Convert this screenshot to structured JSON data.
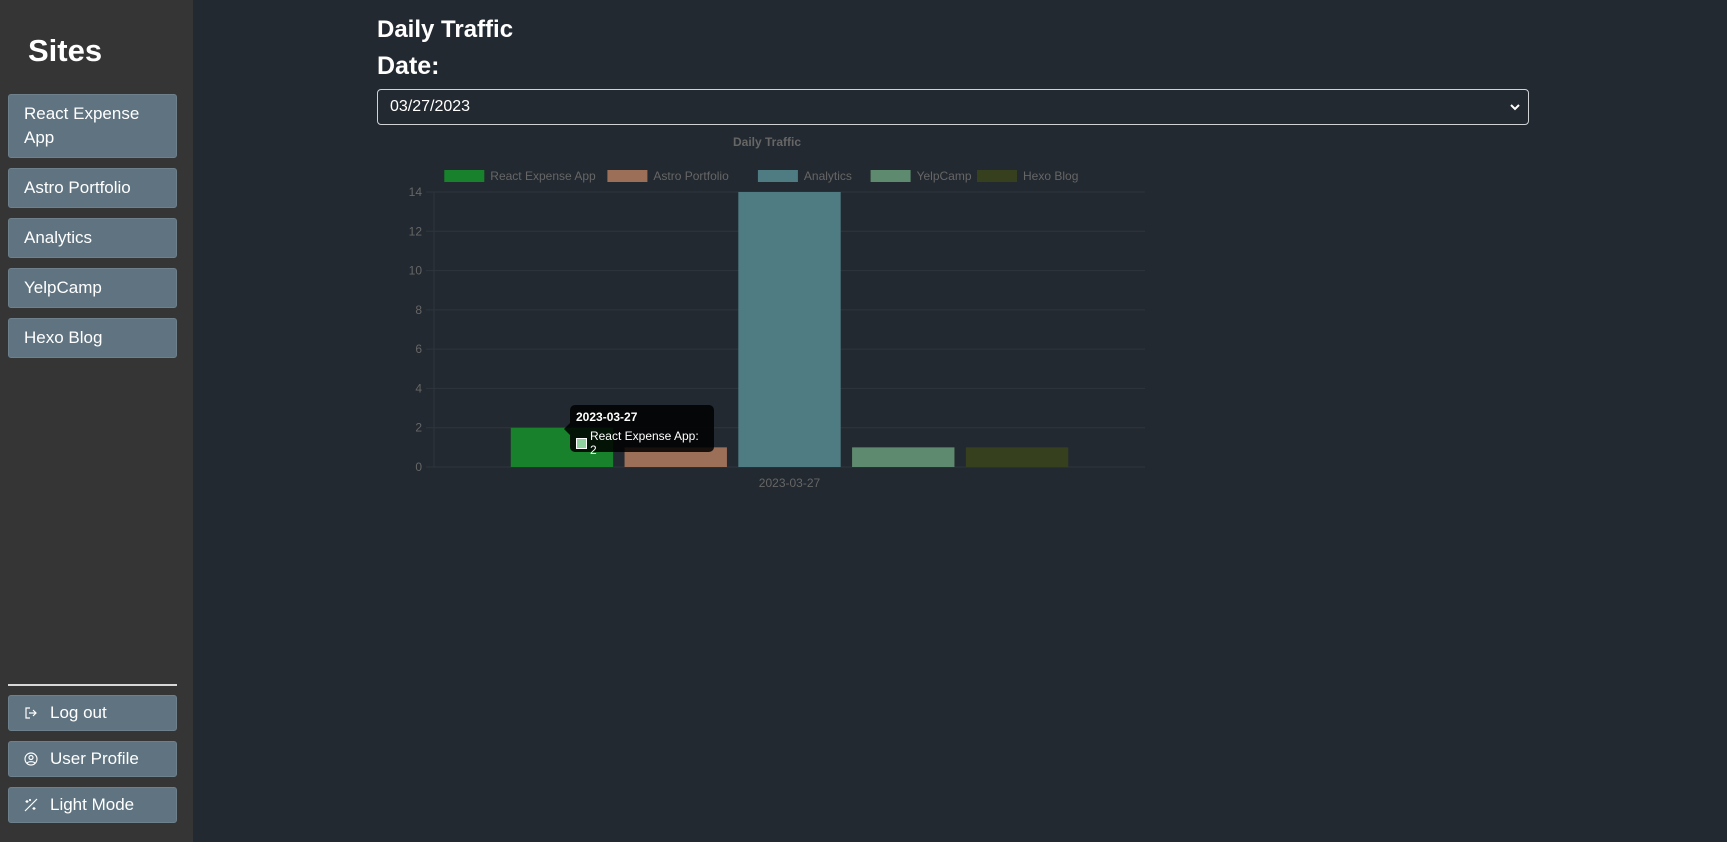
{
  "sidebar": {
    "title": "Sites",
    "sites": [
      {
        "label": "React Expense App"
      },
      {
        "label": "Astro Portfolio"
      },
      {
        "label": "Analytics"
      },
      {
        "label": "YelpCamp"
      },
      {
        "label": "Hexo Blog"
      }
    ],
    "logout_label": "Log out",
    "profile_label": "User Profile",
    "theme_label": "Light Mode"
  },
  "main": {
    "title": "Daily Traffic",
    "date_label": "Date:",
    "date_value": "03/27/2023"
  },
  "tooltip": {
    "title": "2023-03-27",
    "label": "React Expense App: 2",
    "swatch_color": "#8fd19e"
  },
  "chart_data": {
    "type": "bar",
    "title": "Daily Traffic",
    "categories": [
      "2023-03-27"
    ],
    "series": [
      {
        "name": "React Expense App",
        "values": [
          2
        ],
        "color": "#17812b"
      },
      {
        "name": "Astro Portfolio",
        "values": [
          1
        ],
        "color": "#9c6f59"
      },
      {
        "name": "Analytics",
        "values": [
          14
        ],
        "color": "#4e7c82"
      },
      {
        "name": "YelpCamp",
        "values": [
          1
        ],
        "color": "#5e8a6f"
      },
      {
        "name": "Hexo Blog",
        "values": [
          1
        ],
        "color": "#36401f"
      }
    ],
    "ylim": [
      0,
      14
    ],
    "yticks": [
      0,
      2,
      4,
      6,
      8,
      10,
      12,
      14
    ],
    "legend": "top",
    "grid": true
  }
}
